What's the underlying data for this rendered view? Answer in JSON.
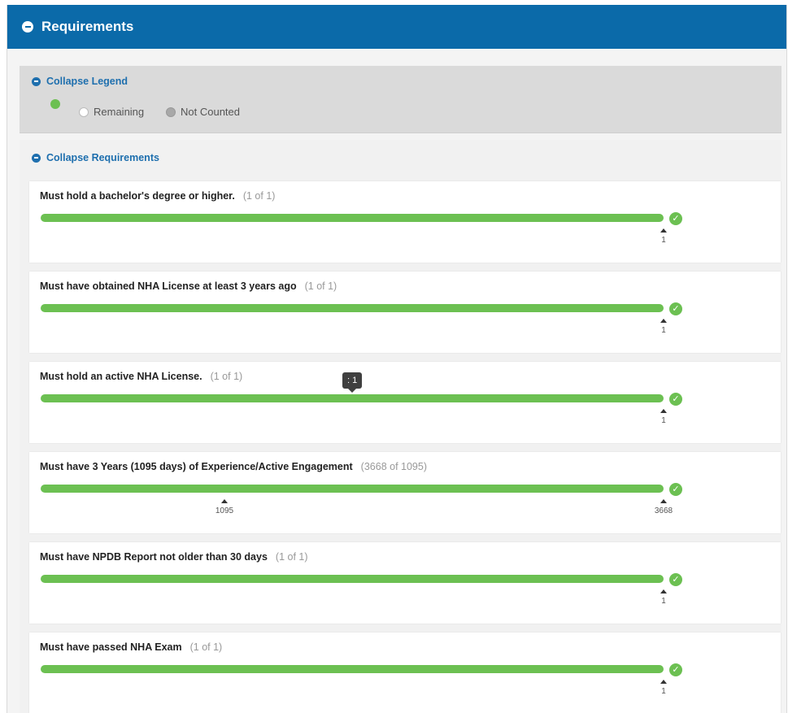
{
  "header": {
    "title": "Requirements"
  },
  "legend": {
    "toggle_label": "Collapse Legend",
    "items": [
      {
        "label": "Remaining"
      },
      {
        "label": "Not Counted"
      }
    ]
  },
  "requirements": {
    "toggle_label": "Collapse Requirements",
    "items": [
      {
        "title": "Must hold a bachelor's degree or higher.",
        "count": "(1 of 1)",
        "ticks": [
          "1"
        ]
      },
      {
        "title": "Must have obtained NHA License at least 3 years ago",
        "count": "(1 of 1)",
        "ticks": [
          "1"
        ]
      },
      {
        "title": "Must hold an active NHA License.",
        "count": "(1 of 1)",
        "ticks": [
          "1"
        ],
        "tooltip": ": 1"
      },
      {
        "title": "Must have 3 Years (1095 days) of Experience/Active Engagement",
        "count": "(3668 of 1095)",
        "ticks": [
          "1095",
          "3668"
        ]
      },
      {
        "title": "Must have NPDB Report not older than 30 days",
        "count": "(1 of 1)",
        "ticks": [
          "1"
        ]
      },
      {
        "title": "Must have passed NHA Exam",
        "count": "(1 of 1)",
        "ticks": [
          "1"
        ]
      }
    ]
  },
  "colors": {
    "header": "#0b6aa9",
    "progress": "#6cc052",
    "link": "#1e6fae"
  },
  "icons": {
    "collapse": "minus-circle-icon",
    "complete": "check-circle-icon"
  }
}
